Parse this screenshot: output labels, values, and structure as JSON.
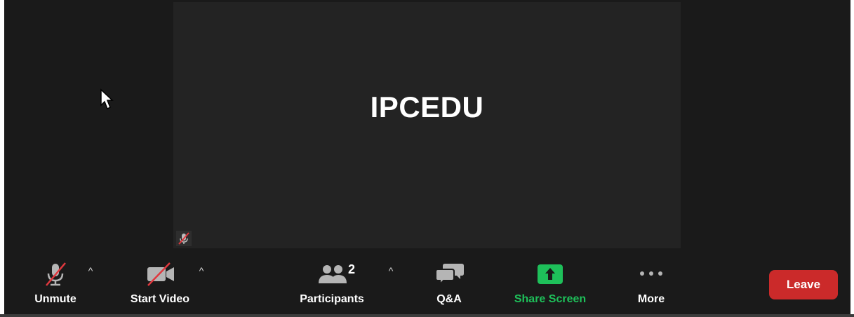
{
  "video": {
    "participant_name": "IPCEDU",
    "muted_indicator_icon": "mic-muted-icon"
  },
  "toolbar": {
    "unmute": {
      "label": "Unmute",
      "icon": "mic-muted-icon"
    },
    "start_video": {
      "label": "Start Video",
      "icon": "video-off-icon"
    },
    "participants": {
      "label": "Participants",
      "count": "2",
      "icon": "participants-icon"
    },
    "qa": {
      "label": "Q&A",
      "icon": "chat-bubbles-icon"
    },
    "share_screen": {
      "label": "Share Screen",
      "icon": "share-screen-icon"
    },
    "more": {
      "label": "More",
      "icon": "more-dots-icon"
    },
    "leave": {
      "label": "Leave"
    }
  },
  "colors": {
    "background": "#1a1a1a",
    "tile": "#232323",
    "muted_red": "#e0383e",
    "share_green": "#1ec05a",
    "leave_red": "#cb2a2a"
  }
}
